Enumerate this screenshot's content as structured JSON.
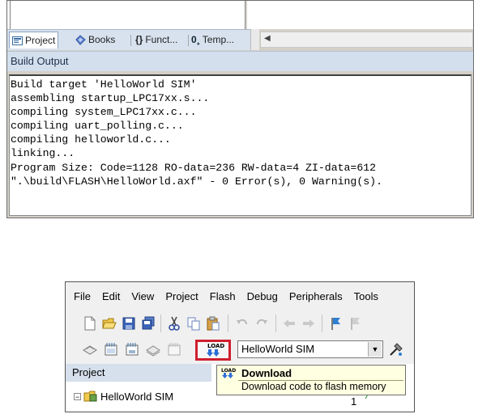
{
  "build_panel": {
    "tabs": [
      {
        "label": "Project",
        "icon": "project-icon"
      },
      {
        "label": "Books",
        "icon": "books-icon"
      },
      {
        "label": "Funct...",
        "icon": "functions-icon"
      },
      {
        "label": "Temp...",
        "icon": "templates-icon"
      }
    ],
    "scroll_left_icon": "chevron-left-icon",
    "title": "Build Output",
    "lines": [
      "Build target 'HelloWorld SIM'",
      "assembling startup_LPC17xx.s...",
      "compiling system_LPC17xx.c...",
      "compiling uart_polling.c...",
      "compiling helloworld.c...",
      "linking...",
      "Program Size: Code=1128 RO-data=236 RW-data=4 ZI-data=612",
      "\".\\build\\FLASH\\HelloWorld.axf\" - 0 Error(s), 0 Warning(s)."
    ]
  },
  "ide": {
    "menu": [
      "File",
      "Edit",
      "View",
      "Project",
      "Flash",
      "Debug",
      "Peripherals",
      "Tools"
    ],
    "toolbar1_icons": [
      "new-file-icon",
      "open-folder-icon",
      "save-icon",
      "save-all-icon",
      "cut-icon",
      "copy-icon",
      "paste-icon",
      "undo-icon",
      "redo-icon",
      "nav-back-icon",
      "nav-forward-icon",
      "bookmark-icon",
      "bookmark-next-icon"
    ],
    "toolbar2_icons": [
      "translate-icon",
      "build-icon",
      "rebuild-icon",
      "batch-build-icon",
      "stop-build-icon"
    ],
    "load_button": {
      "label": "LOAD",
      "icon": "download-arrow-icon",
      "highlight_color": "#d01f2d"
    },
    "target_select": {
      "value": "HelloWorld SIM"
    },
    "options_icon": "target-options-icon",
    "project_panel": {
      "header": "Project",
      "tree": [
        {
          "expander": "−",
          "label": "HelloWorld SIM",
          "icon": "target-folder-icon"
        }
      ]
    },
    "tooltip": {
      "title": "Download",
      "description": "Download code to flash memory"
    },
    "editor": {
      "line_number": "1",
      "code_fragment": "/***"
    }
  }
}
